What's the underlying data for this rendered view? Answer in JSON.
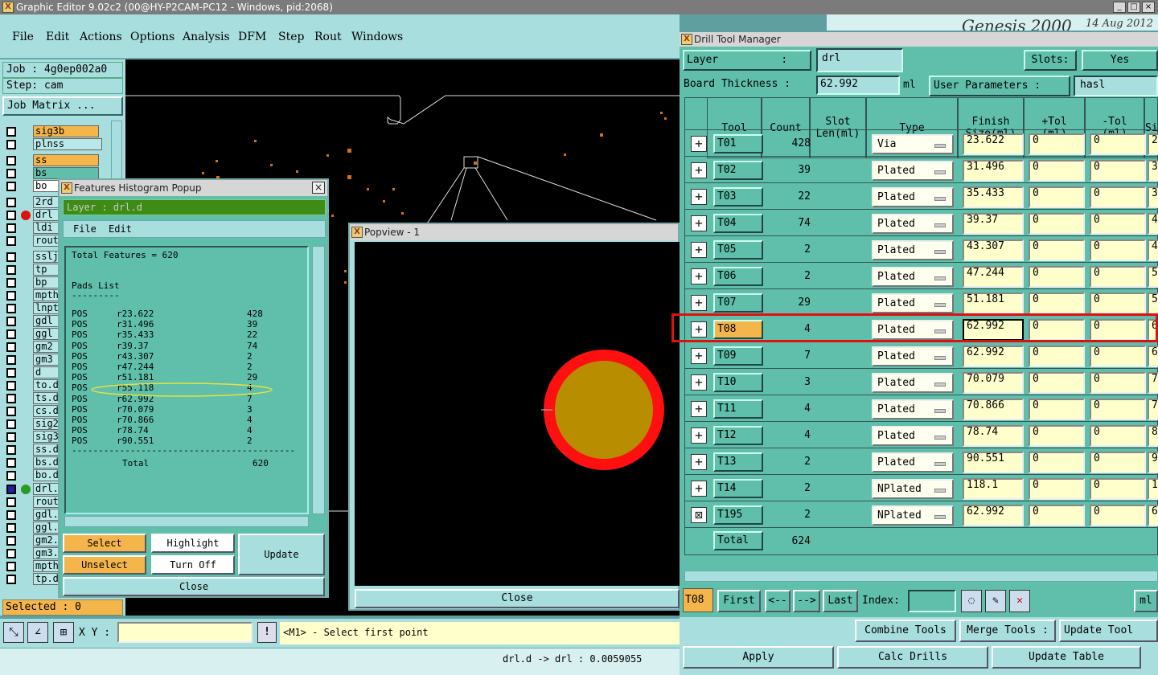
{
  "app": {
    "title": "Graphic Editor 9.02c2 (00@HY-P2CAM-PC12 - Windows, pid:2068)",
    "banner_title": "Genesis 2000",
    "banner_date": "14 Aug 2012"
  },
  "menu": [
    "File",
    "Edit",
    "Actions",
    "Options",
    "Analysis",
    "DFM",
    "Step",
    "Rout",
    "Windows"
  ],
  "left": {
    "job": "Job : 4g0ep002a0",
    "step": "Step: cam",
    "job_matrix": "Job Matrix ...",
    "layers": [
      {
        "name": "sig3b",
        "color": "#f4b64a"
      },
      {
        "name": "plnss",
        "color": "#b8e8e8"
      },
      {
        "name": "ss",
        "color": "#f4b64a"
      },
      {
        "name": "bs",
        "color": "#5fbfaa"
      },
      {
        "name": "bo",
        "color": "#ffffff"
      },
      {
        "name": "2rd",
        "color": "#b8e8e8"
      },
      {
        "name": "drl",
        "color": "#b8e8e8"
      },
      {
        "name": "ldi",
        "color": "#b8e8e8"
      },
      {
        "name": "rout",
        "color": "#b8e8e8"
      },
      {
        "name": "sslj",
        "color": "#b8e8e8"
      },
      {
        "name": "tp",
        "color": "#b8e8e8"
      },
      {
        "name": "bp",
        "color": "#b8e8e8"
      },
      {
        "name": "mpth",
        "color": "#b8e8e8"
      },
      {
        "name": "lnpt",
        "color": "#b8e8e8"
      },
      {
        "name": "gdl",
        "color": "#b8e8e8"
      },
      {
        "name": "ggl",
        "color": "#b8e8e8"
      },
      {
        "name": "gm2",
        "color": "#b8e8e8"
      },
      {
        "name": "gm3",
        "color": "#b8e8e8"
      },
      {
        "name": "d",
        "color": "#b8e8e8"
      },
      {
        "name": "to.d",
        "color": "#b8e8e8"
      },
      {
        "name": "ts.d",
        "color": "#b8e8e8"
      },
      {
        "name": "cs.d",
        "color": "#b8e8e8"
      },
      {
        "name": "sig2",
        "color": "#b8e8e8"
      },
      {
        "name": "sig3",
        "color": "#b8e8e8"
      },
      {
        "name": "ss.d",
        "color": "#b8e8e8"
      },
      {
        "name": "bs.d",
        "color": "#b8e8e8"
      },
      {
        "name": "bo.d",
        "color": "#b8e8e8"
      },
      {
        "name": "drl.",
        "color": "#b8e8e8"
      },
      {
        "name": "rout",
        "color": "#b8e8e8"
      },
      {
        "name": "gdl.",
        "color": "#b8e8e8"
      },
      {
        "name": "ggl.",
        "color": "#b8e8e8"
      },
      {
        "name": "gm2.",
        "color": "#b8e8e8"
      },
      {
        "name": "gm3.",
        "color": "#b8e8e8"
      },
      {
        "name": "mpth",
        "color": "#b8e8e8"
      },
      {
        "name": "tp.d",
        "color": "#b8e8e8"
      }
    ],
    "selected": "Selected : 0"
  },
  "status": {
    "xy_label": "X Y :",
    "prompt": "<M1> - Select first point",
    "bottom": "drl.d -> drl : 0.0059055"
  },
  "histogram": {
    "title": "Features Histogram Popup",
    "layer": "Layer :  drl.d",
    "menu": [
      "File",
      "Edit"
    ],
    "total_features": "Total Features = 620",
    "pads_list": "Pads List",
    "underline": "---------",
    "rows": [
      [
        "POS",
        "r23.622",
        "428"
      ],
      [
        "POS",
        "r31.496",
        "39"
      ],
      [
        "POS",
        "r35.433",
        "22"
      ],
      [
        "POS",
        "r39.37",
        "74"
      ],
      [
        "POS",
        "r43.307",
        "2"
      ],
      [
        "POS",
        "r47.244",
        "2"
      ],
      [
        "POS",
        "r51.181",
        "29"
      ],
      [
        "POS",
        "r55.118",
        "4"
      ],
      [
        "POS",
        "r62.992",
        "7"
      ],
      [
        "POS",
        "r70.079",
        "3"
      ],
      [
        "POS",
        "r70.866",
        "4"
      ],
      [
        "POS",
        "r78.74",
        "4"
      ],
      [
        "POS",
        "r90.551",
        "2"
      ]
    ],
    "separator": "------------------------------------------",
    "total_label": "Total",
    "total_value": "620",
    "buttons": {
      "select": "Select",
      "highlight": "Highlight",
      "update": "Update",
      "unselect": "Unselect",
      "turn_off": "Turn Off",
      "close": "Close"
    }
  },
  "popview": {
    "title": "Popview - 1",
    "close": "Close"
  },
  "dtm": {
    "title": "Drill Tool Manager",
    "layer_label": "Layer          :",
    "layer_value": "drl",
    "slots_label": "Slots:",
    "slots_value": "Yes",
    "board_thickness_label": "Board Thickness :",
    "board_thickness_value": "62.992",
    "board_thickness_unit": "ml",
    "user_params_label": "User Parameters :",
    "user_params_value": "hasl",
    "headers": {
      "tool": "Tool",
      "count": "Count",
      "slot": "Slot\nLen(ml)",
      "type": "Type",
      "finish": "Finish\nSize(ml)",
      "ptol": "+Tol\n(ml)",
      "ntol": "-Tol\n(ml)",
      "extra": "Si"
    },
    "rows": [
      {
        "tool": "T01",
        "count": "428",
        "type": "Via",
        "finish": "23.622",
        "ptol": "0",
        "ntol": "0",
        "extra": "2"
      },
      {
        "tool": "T02",
        "count": "39",
        "type": "Plated",
        "finish": "31.496",
        "ptol": "0",
        "ntol": "0",
        "extra": "3"
      },
      {
        "tool": "T03",
        "count": "22",
        "type": "Plated",
        "finish": "35.433",
        "ptol": "0",
        "ntol": "0",
        "extra": "3"
      },
      {
        "tool": "T04",
        "count": "74",
        "type": "Plated",
        "finish": "39.37",
        "ptol": "0",
        "ntol": "0",
        "extra": "4"
      },
      {
        "tool": "T05",
        "count": "2",
        "type": "Plated",
        "finish": "43.307",
        "ptol": "0",
        "ntol": "0",
        "extra": "4"
      },
      {
        "tool": "T06",
        "count": "2",
        "type": "Plated",
        "finish": "47.244",
        "ptol": "0",
        "ntol": "0",
        "extra": "5"
      },
      {
        "tool": "T07",
        "count": "29",
        "type": "Plated",
        "finish": "51.181",
        "ptol": "0",
        "ntol": "0",
        "extra": "5"
      },
      {
        "tool": "T08",
        "count": "4",
        "type": "Plated",
        "finish": "62.992",
        "ptol": "0",
        "ntol": "0",
        "extra": "6"
      },
      {
        "tool": "T09",
        "count": "7",
        "type": "Plated",
        "finish": "62.992",
        "ptol": "0",
        "ntol": "0",
        "extra": "6"
      },
      {
        "tool": "T10",
        "count": "3",
        "type": "Plated",
        "finish": "70.079",
        "ptol": "0",
        "ntol": "0",
        "extra": "7"
      },
      {
        "tool": "T11",
        "count": "4",
        "type": "Plated",
        "finish": "70.866",
        "ptol": "0",
        "ntol": "0",
        "extra": "7"
      },
      {
        "tool": "T12",
        "count": "4",
        "type": "Plated",
        "finish": "78.74",
        "ptol": "0",
        "ntol": "0",
        "extra": "8"
      },
      {
        "tool": "T13",
        "count": "2",
        "type": "Plated",
        "finish": "90.551",
        "ptol": "0",
        "ntol": "0",
        "extra": "9"
      },
      {
        "tool": "T14",
        "count": "2",
        "type": "NPlated",
        "finish": "118.1",
        "ptol": "0",
        "ntol": "0",
        "extra": "1"
      },
      {
        "tool": "T195",
        "count": "2",
        "type": "NPlated",
        "finish": "62.992",
        "ptol": "0",
        "ntol": "0",
        "extra": "6"
      }
    ],
    "total_label": "Total",
    "total_count": "624",
    "current_tool": "T08",
    "nav": {
      "first": "First",
      "prev": "<--",
      "next": "-->",
      "last": "Last",
      "index_label": "Index:",
      "ml": "ml"
    },
    "actions": {
      "combine": "Combine Tools",
      "merge": "Merge Tools :",
      "update_tools": "Update Tool",
      "apply": "Apply",
      "calc": "Calc Drills",
      "update_table": "Update Table"
    }
  }
}
